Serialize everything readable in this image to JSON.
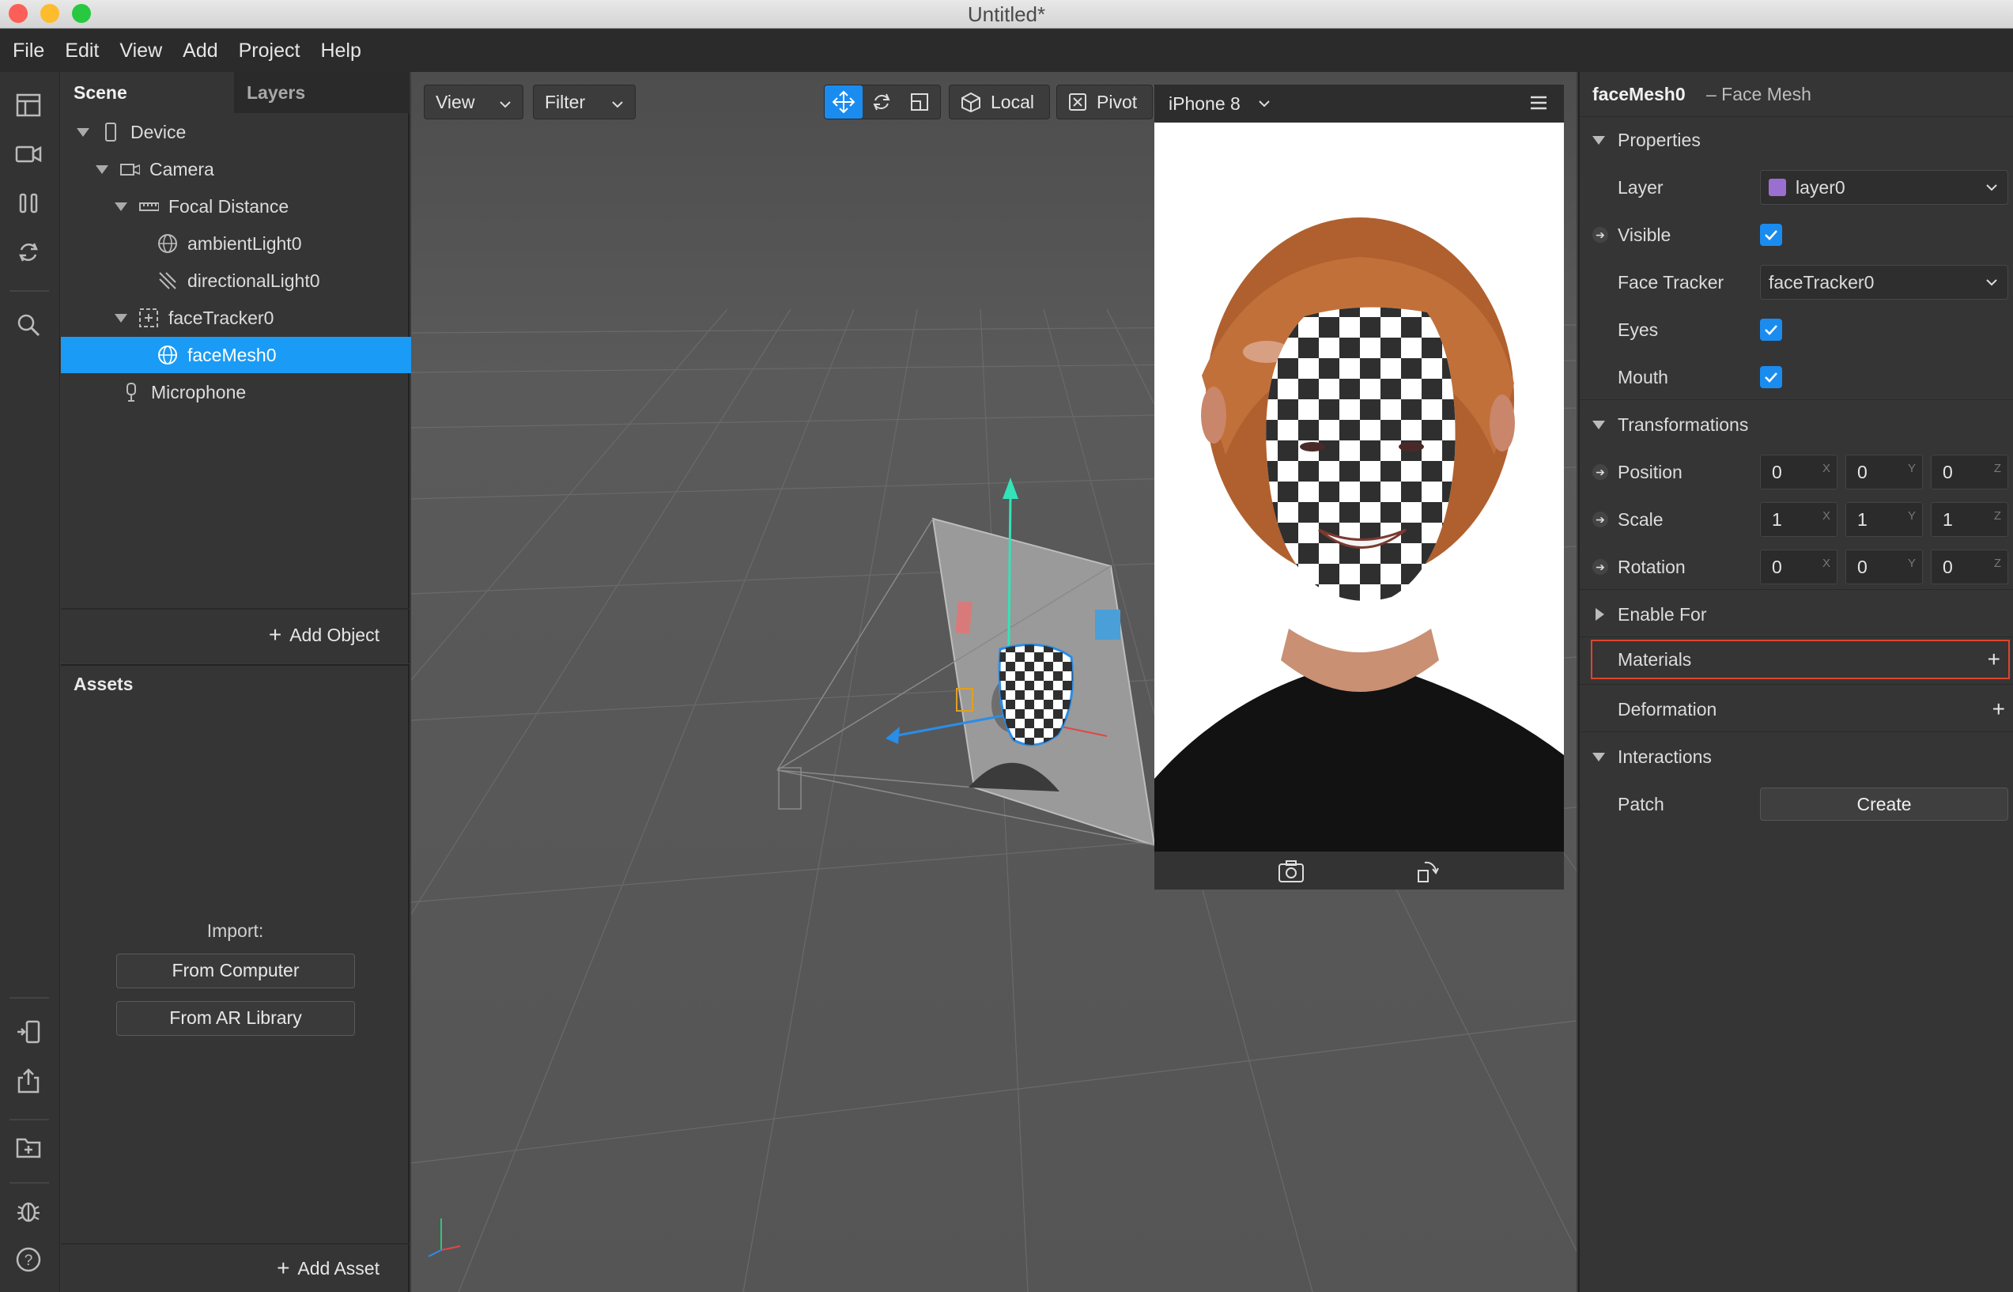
{
  "window": {
    "title": "Untitled*"
  },
  "menu": [
    "File",
    "Edit",
    "View",
    "Add",
    "Project",
    "Help"
  ],
  "scene_panel": {
    "tabs": [
      "Scene",
      "Layers"
    ],
    "tree": [
      {
        "label": "Device",
        "icon": "phone-icon",
        "expanded": true
      },
      {
        "label": "Camera",
        "icon": "camera-icon",
        "expanded": true
      },
      {
        "label": "Focal Distance",
        "icon": "ruler-icon",
        "expanded": true
      },
      {
        "label": "ambientLight0",
        "icon": "globe-icon"
      },
      {
        "label": "directionalLight0",
        "icon": "directional-light-icon"
      },
      {
        "label": "faceTracker0",
        "icon": "face-tracker-icon",
        "expanded": true
      },
      {
        "label": "faceMesh0",
        "icon": "globe-icon",
        "selected": true
      },
      {
        "label": "Microphone",
        "icon": "microphone-icon"
      }
    ],
    "add_object": "Add Object"
  },
  "assets_panel": {
    "title": "Assets",
    "import_label": "Import:",
    "from_computer": "From Computer",
    "from_ar_library": "From AR Library",
    "add_asset": "Add Asset"
  },
  "viewport": {
    "view_button": "View",
    "filter_button": "Filter",
    "local_button": "Local",
    "pivot_button": "Pivot"
  },
  "simulator": {
    "device": "iPhone 8"
  },
  "inspector": {
    "object_name": "faceMesh0",
    "object_type": "– Face Mesh",
    "properties_header": "Properties",
    "layer_label": "Layer",
    "layer_value": "layer0",
    "layer_color": "#9b6fd0",
    "visible_label": "Visible",
    "face_tracker_label": "Face Tracker",
    "face_tracker_value": "faceTracker0",
    "eyes_label": "Eyes",
    "mouth_label": "Mouth",
    "transformations_header": "Transformations",
    "position_label": "Position",
    "position": [
      "0",
      "0",
      "0"
    ],
    "scale_label": "Scale",
    "scale": [
      "1",
      "1",
      "1"
    ],
    "rotation_label": "Rotation",
    "rotation": [
      "0",
      "0",
      "0"
    ],
    "axis_labels": [
      "X",
      "Y",
      "Z"
    ],
    "enable_for": "Enable For",
    "materials": "Materials",
    "deformation": "Deformation",
    "interactions_header": "Interactions",
    "patch_label": "Patch",
    "create_button": "Create"
  },
  "colors": {
    "selection": "#1a9bf5",
    "checkbox": "#1a8cf0",
    "highlight_border": "#e0442e"
  }
}
